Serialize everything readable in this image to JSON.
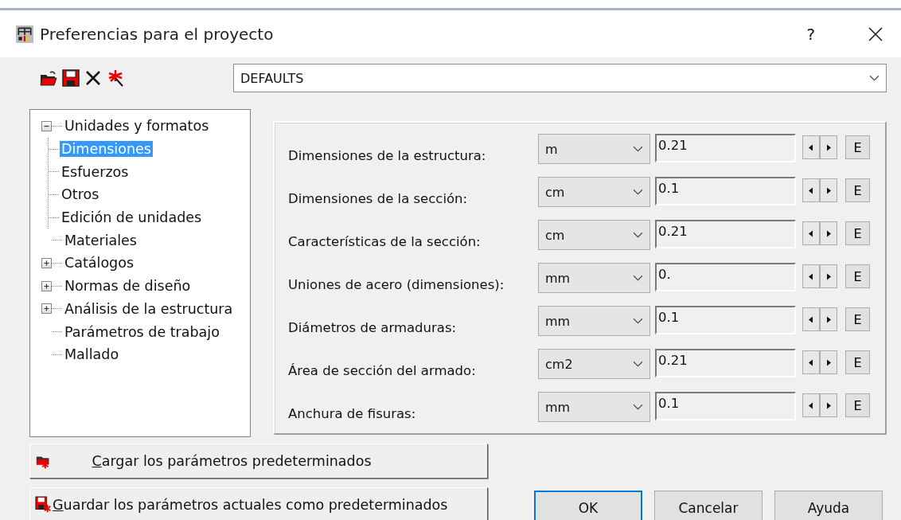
{
  "window": {
    "title": "Preferencias para el proyecto"
  },
  "profile": {
    "value": "DEFAULTS"
  },
  "tree": [
    {
      "label": "Unidades y formatos",
      "selected": false,
      "expanded": true,
      "children": [
        {
          "label": "Dimensiones",
          "selected": true
        },
        {
          "label": "Esfuerzos",
          "selected": false
        },
        {
          "label": "Otros",
          "selected": false
        },
        {
          "label": "Edición de unidades",
          "selected": false
        }
      ]
    },
    {
      "label": "Materiales",
      "selected": false
    },
    {
      "label": "Catálogos",
      "selected": false,
      "expanded": false
    },
    {
      "label": "Normas de diseño",
      "selected": false,
      "expanded": false
    },
    {
      "label": "Análisis de la estructura",
      "selected": false,
      "expanded": false
    },
    {
      "label": "Parámetros de trabajo",
      "selected": false
    },
    {
      "label": "Mallado",
      "selected": false
    }
  ],
  "settings": [
    {
      "label": "Dimensiones de la estructura:",
      "unit": "m",
      "value": "0.21",
      "edit_button": "E"
    },
    {
      "label": "Dimensiones de la sección:",
      "unit": "cm",
      "value": "0.1",
      "edit_button": "E"
    },
    {
      "label": "Características de la sección:",
      "unit": "cm",
      "value": "0.21",
      "edit_button": "E"
    },
    {
      "label": "Uniones de acero (dimensiones):",
      "unit": "mm",
      "value": "0.",
      "edit_button": "E"
    },
    {
      "label": "Diámetros de armaduras:",
      "unit": "mm",
      "value": "0.1",
      "edit_button": "E"
    },
    {
      "label": "Área de sección del armado:",
      "unit": "cm2",
      "value": "0.21",
      "edit_button": "E"
    },
    {
      "label": "Anchura de fisuras:",
      "unit": "mm",
      "value": "0.1",
      "edit_button": "E"
    }
  ],
  "default_buttons": [
    {
      "label": "Cargar los parámetros predeterminados",
      "kind": "load"
    },
    {
      "label": "Guardar los parámetros actuales como predeterminados",
      "kind": "save"
    }
  ],
  "dialog_buttons": [
    {
      "label": "OK",
      "selected": true
    },
    {
      "label": "Cancelar",
      "selected": false
    },
    {
      "label": "Ayuda",
      "selected": false
    }
  ],
  "title_buttons": [
    "?"
  ]
}
